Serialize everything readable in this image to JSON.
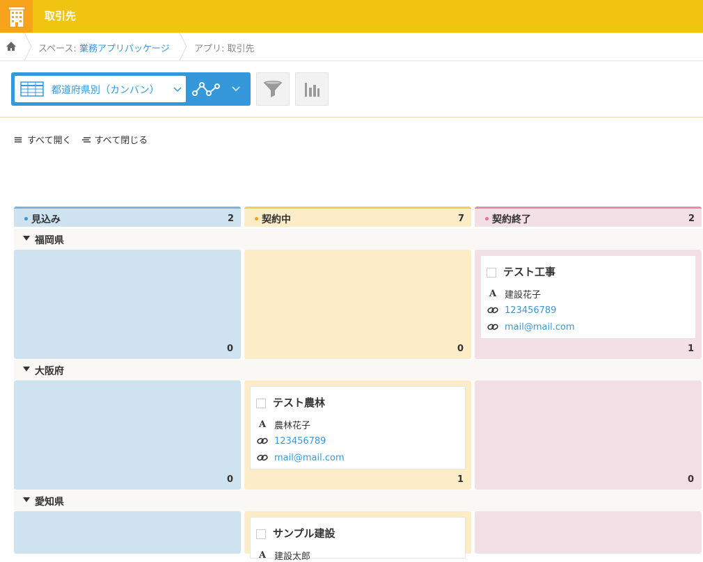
{
  "header": {
    "app_title": "取引先",
    "app_icon": "building-icon"
  },
  "breadcrumb": {
    "home_icon": "home-icon",
    "space_prefix": "スペース: ",
    "space_name": "業務アプリパッケージ",
    "app_prefix": "アプリ: ",
    "app_name": "取引先"
  },
  "toolbar": {
    "view_label": "都道府県別（カンバン）",
    "view_icon": "table-icon",
    "graph_icon": "line-graph-icon",
    "filter_icon": "filter-icon",
    "chart_icon": "bar-chart-icon"
  },
  "expand": {
    "open_all": "すべて開く",
    "close_all": "すべて閉じる"
  },
  "columns": [
    {
      "name": "見込み",
      "count": "2",
      "color": "#cfe2f0",
      "accent": "#7fb3de",
      "dot": "#3498db"
    },
    {
      "name": "契約中",
      "count": "7",
      "color": "#fcecc8",
      "accent": "#f6c95a",
      "dot": "#f2a10f"
    },
    {
      "name": "契約終了",
      "count": "2",
      "color": "#f3dfe6",
      "accent": "#e88aab",
      "dot": "#e5729c"
    }
  ],
  "groups": [
    {
      "name": "福岡県",
      "counts": [
        "0",
        "0",
        "1"
      ]
    },
    {
      "name": "大阪府",
      "counts": [
        "0",
        "1",
        "0"
      ]
    },
    {
      "name": "愛知県",
      "counts": [
        "",
        "",
        ""
      ]
    }
  ],
  "cards": [
    {
      "title": "テスト工事",
      "person": "建設花子",
      "phone": "123456789",
      "email": "mail@mail.com"
    },
    {
      "title": "テスト農林",
      "person": "農林花子",
      "phone": "123456789",
      "email": "mail@mail.com"
    },
    {
      "title": "サンプル建設",
      "person": "建設太郎",
      "phone": "",
      "email": ""
    }
  ]
}
